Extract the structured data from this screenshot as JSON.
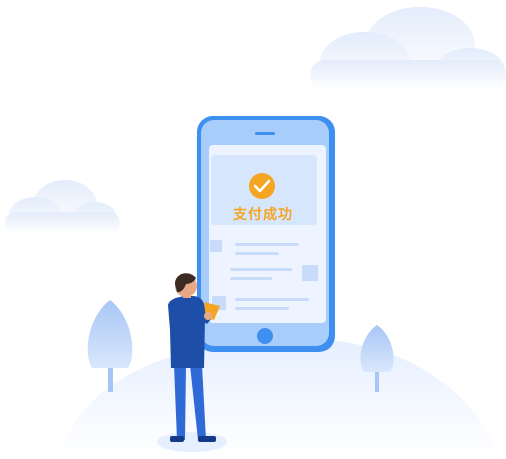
{
  "status": {
    "text": "支付成功",
    "icon": "check-circle-icon"
  },
  "colors": {
    "accent": "#f5a524",
    "phone_blue": "#3d8ff0",
    "screen": "#e8f1ff",
    "figure_blue": "#1d4fa8"
  }
}
